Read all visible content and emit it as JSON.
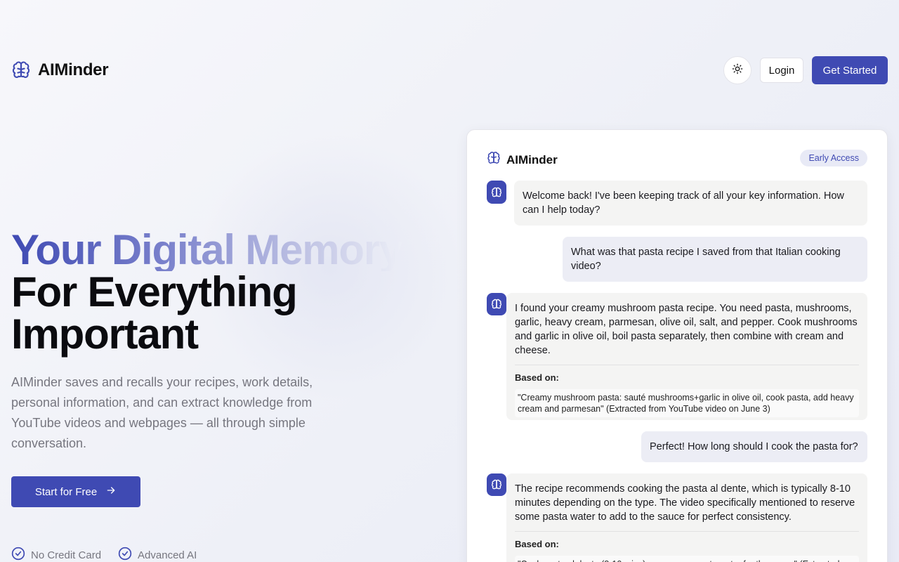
{
  "brand": {
    "name": "AIMinder",
    "icon": "brain-icon"
  },
  "header": {
    "theme_icon": "sun-icon",
    "login_label": "Login",
    "get_started_label": "Get Started"
  },
  "hero": {
    "title_gradient": "Your Digital Memory",
    "title_line2": "For Everything",
    "title_line3": "Important",
    "description": "AIMinder saves and recalls your recipes, work details, personal information, and can extract knowledge from YouTube videos and webpages — all through simple conversation.",
    "cta_label": "Start for Free",
    "features": [
      "No Credit Card",
      "Advanced AI"
    ]
  },
  "chat": {
    "title": "AIMinder",
    "badge": "Early Access",
    "messages": [
      {
        "role": "bot",
        "text": "Welcome back! I've been keeping track of all your key information. How can I help today?"
      },
      {
        "role": "user",
        "text": "What was that pasta recipe I saved from that Italian cooking video?"
      },
      {
        "role": "bot",
        "text": "I found your creamy mushroom pasta recipe. You need pasta, mushrooms, garlic, heavy cream, parmesan, olive oil, salt, and pepper. Cook mushrooms and garlic in olive oil, boil pasta separately, then combine with cream and cheese.",
        "based_label": "Based on:",
        "based_quote": "\"Creamy mushroom pasta: sauté mushrooms+garlic in olive oil, cook pasta, add heavy cream and parmesan\" (Extracted from YouTube video on June 3)"
      },
      {
        "role": "user",
        "text": "Perfect! How long should I cook the pasta for?"
      },
      {
        "role": "bot",
        "text": "The recipe recommends cooking the pasta al dente, which is typically 8-10 minutes depending on the type. The video specifically mentioned to reserve some pasta water to add to the sauce for perfect consistency.",
        "based_label": "Based on:",
        "based_quote": "\"Cook pasta al dente (8-10 mins), save some pasta water for the sauce\" (Extracted"
      }
    ]
  },
  "colors": {
    "accent": "#3f4ab3",
    "muted_text": "#76767f"
  }
}
